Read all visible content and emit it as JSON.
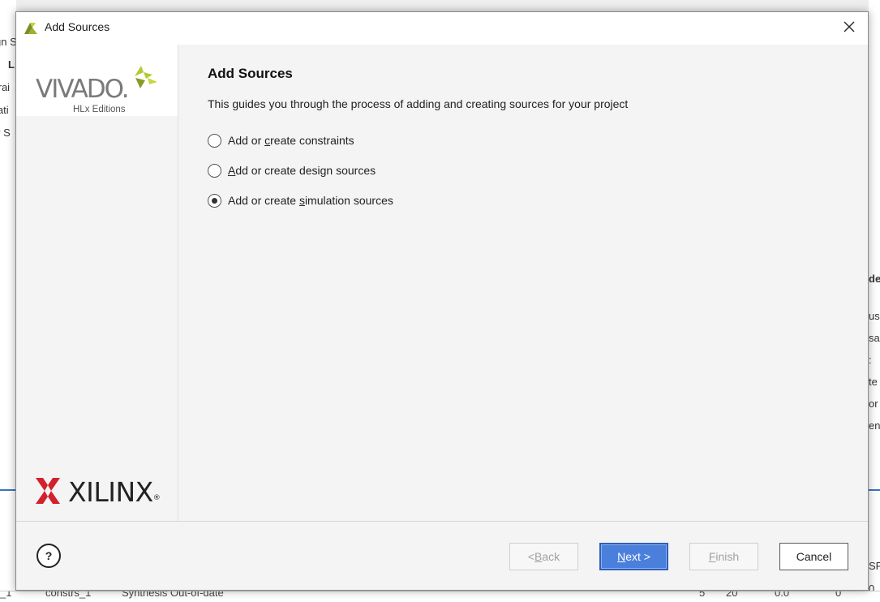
{
  "background": {
    "left_fragments": [
      "gn S",
      "L",
      "trai",
      "lati",
      "y S"
    ],
    "right_fragments": [
      "de",
      "us",
      "sa",
      ":",
      "te",
      "or",
      "en",
      "SP",
      "0"
    ],
    "bottom_fragments": [
      "_1",
      "constrs_1",
      "Synthesis Out-of-date",
      "5",
      "20",
      "0.0",
      "0"
    ]
  },
  "dialog": {
    "title": "Add Sources",
    "close_glyph": "✕",
    "sidebar": {
      "vivado_logo_text": "VIVADO.",
      "vivado_logo_sub": "HLx Editions",
      "xilinx_logo_text": "XILINX",
      "xilinx_logo_reg": "®"
    },
    "content": {
      "title": "Add Sources",
      "description": "This guides you through the process of adding and creating sources for your project",
      "options": [
        {
          "pre": "Add or ",
          "mnemonic": "c",
          "post": "reate constraints",
          "selected": false
        },
        {
          "pre": "",
          "mnemonic": "A",
          "post": "dd or create design sources",
          "selected": false
        },
        {
          "pre": "Add or create ",
          "mnemonic": "s",
          "post": "imulation sources",
          "selected": true
        }
      ]
    },
    "footer": {
      "help_label": "?",
      "back": {
        "pre": "< ",
        "mnemonic": "B",
        "post": "ack",
        "enabled": false
      },
      "next": {
        "pre": "",
        "mnemonic": "N",
        "post": "ext >",
        "enabled": true
      },
      "finish": {
        "pre": "",
        "mnemonic": "F",
        "post": "inish",
        "enabled": false
      },
      "cancel": {
        "label": "Cancel",
        "enabled": true
      }
    }
  },
  "colors": {
    "primary_button": "#4a7fdc",
    "vivado_green": "#b5c933",
    "xilinx_red": "#d3202e"
  }
}
